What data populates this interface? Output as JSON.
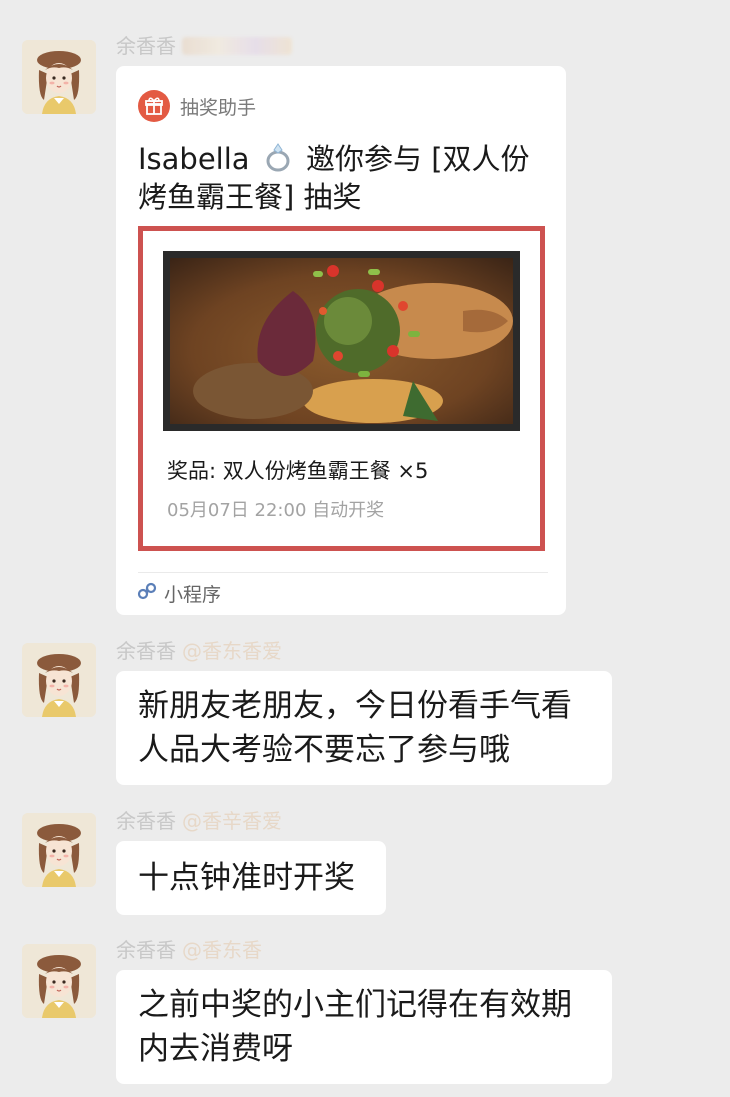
{
  "colors": {
    "background": "#ececec",
    "bubble": "#ffffff",
    "promo_border": "#cd5250",
    "gift_icon_bg": "#e35a43",
    "link_blue": "#5b7fb8"
  },
  "messages": [
    {
      "type": "mini_program",
      "sender": "余香香",
      "card": {
        "app_name": "抽奖助手",
        "title_name": "Isabella",
        "title_text": "邀你参与 [双人份烤鱼霸王餐] 抽奖",
        "prize": "奖品: 双人份烤鱼霸王餐 ×5",
        "draw_time": "05月07日 22:00 自动开奖",
        "footer_label": "小程序",
        "icons": [
          "gift-icon",
          "ring-icon",
          "mini-program-icon"
        ]
      }
    },
    {
      "type": "text",
      "sender": "余香香",
      "sender_tag": "@香东香爱",
      "text": "新朋友老朋友，今日份看手气看人品大考验不要忘了参与哦"
    },
    {
      "type": "text",
      "sender": "余香香",
      "sender_tag": "@香辛香爱",
      "text": "十点钟准时开奖"
    },
    {
      "type": "text",
      "sender": "余香香",
      "sender_tag": "@香东香",
      "text": "之前中奖的小主们记得在有效期内去消费呀"
    }
  ]
}
